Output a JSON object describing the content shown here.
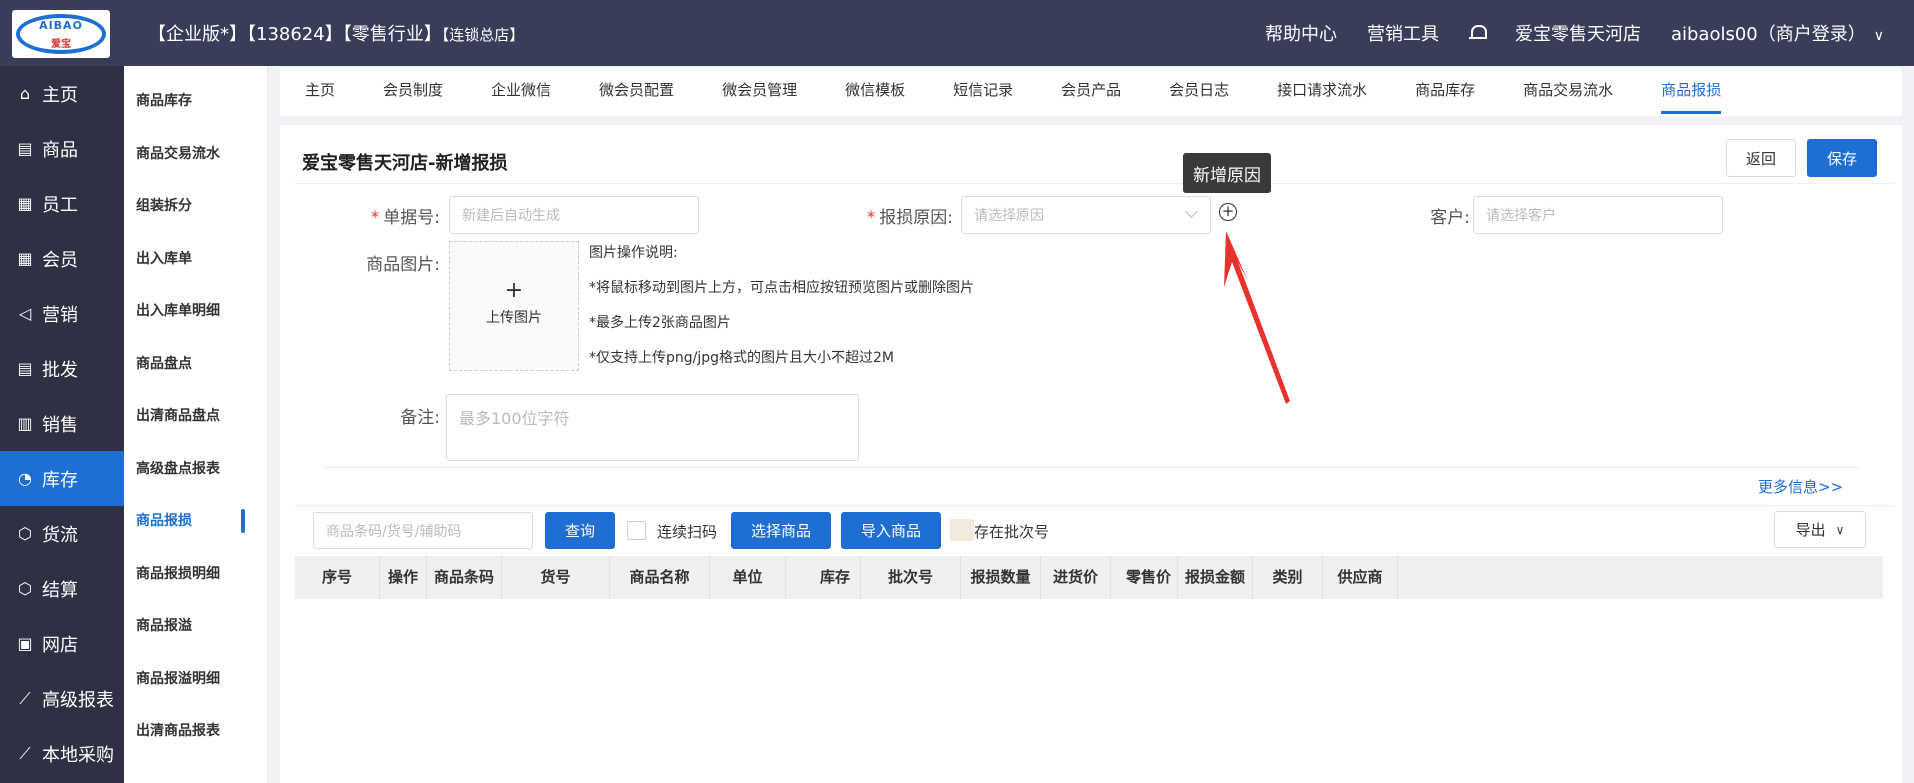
{
  "header": {
    "logo_text": "AIBAO",
    "logo_sub": "爱宝",
    "title_main": "【企业版*】【138624】【零售行业】",
    "title_tail": "【连锁总店】",
    "help": "帮助中心",
    "tools": "营销工具",
    "store": "爱宝零售天河店",
    "user": "aibaols00（商户登录）"
  },
  "sidebar": {
    "items": [
      {
        "label": "主页",
        "icon": "⌂"
      },
      {
        "label": "商品",
        "icon": "▤"
      },
      {
        "label": "员工",
        "icon": "▦"
      },
      {
        "label": "会员",
        "icon": "▦"
      },
      {
        "label": "营销",
        "icon": "◁"
      },
      {
        "label": "批发",
        "icon": "▤"
      },
      {
        "label": "销售",
        "icon": "▥"
      },
      {
        "label": "库存",
        "icon": "◔"
      },
      {
        "label": "货流",
        "icon": "⬡"
      },
      {
        "label": "结算",
        "icon": "⬡"
      },
      {
        "label": "网店",
        "icon": "▣"
      },
      {
        "label": "高级报表",
        "icon": "⟋"
      },
      {
        "label": "本地采购",
        "icon": "⟋"
      }
    ],
    "active_index": 7
  },
  "subsidebar": {
    "items": [
      "商品库存",
      "商品交易流水",
      "组装拆分",
      "出入库单",
      "出入库单明细",
      "商品盘点",
      "出清商品盘点",
      "高级盘点报表",
      "商品报损",
      "商品报损明细",
      "商品报溢",
      "商品报溢明细",
      "出清商品报表"
    ],
    "active_index": 8
  },
  "tabs": {
    "items": [
      "主页",
      "会员制度",
      "企业微信",
      "微会员配置",
      "微会员管理",
      "微信模板",
      "短信记录",
      "会员产品",
      "会员日志",
      "接口请求流水",
      "商品库存",
      "商品交易流水",
      "商品报损"
    ],
    "active_index": 12
  },
  "page": {
    "title": "爱宝零售天河店-新增报损",
    "back_label": "返回",
    "save_label": "保存",
    "tooltip": "新增原因"
  },
  "form": {
    "doc_no_label": "单据号:",
    "doc_no_placeholder": "新建后自动生成",
    "reason_label": "报损原因:",
    "reason_placeholder": "请选择原因",
    "customer_label": "客户:",
    "customer_placeholder": "请选择客户",
    "image_label": "商品图片:",
    "upload_plus": "+",
    "upload_label": "上传图片",
    "image_notes": [
      "图片操作说明:",
      "*将鼠标移动到图片上方，可点击相应按钮预览图片或删除图片",
      "*最多上传2张商品图片",
      "*仅支持上传png/jpg格式的图片且大小不超过2M"
    ],
    "remark_label": "备注:",
    "remark_placeholder": "最多100位字符",
    "more_link": "更多信息>>"
  },
  "toolbar": {
    "search_placeholder": "商品条码/货号/辅助码",
    "query_label": "查询",
    "continuous_scan_label": "连续扫码",
    "select_goods_label": "选择商品",
    "import_goods_label": "导入商品",
    "batch_label": "存在批次号",
    "export_label": "导出"
  },
  "table": {
    "columns": [
      "序号",
      "操作",
      "商品条码",
      "货号",
      "商品名称",
      "单位",
      "库存",
      "批次号",
      "报损数量",
      "进货价",
      "零售价",
      "报损金额",
      "类别",
      "供应商"
    ]
  }
}
